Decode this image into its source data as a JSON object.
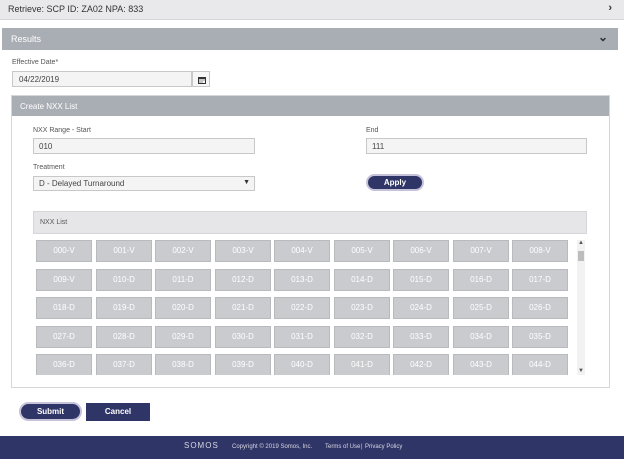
{
  "retrieve": {
    "title": "Retrieve: SCP ID: ZA02 NPA: 833",
    "chevron": "›"
  },
  "results": {
    "title": "Results",
    "chevron": "⌄"
  },
  "effective_date": {
    "label": "Effective Date*",
    "value": "04/22/2019",
    "icon": "calendar-icon"
  },
  "create": {
    "title": "Create NXX List",
    "range_start_label": "NXX Range - Start",
    "range_start_value": "010",
    "end_label": "End",
    "end_value": "111",
    "treatment_label": "Treatment",
    "treatment_value": "D - Delayed Turnaround",
    "apply_label": "Apply"
  },
  "nxx_list": {
    "label": "NXX List",
    "items": [
      "000-V",
      "001-V",
      "002-V",
      "003-V",
      "004-V",
      "005-V",
      "006-V",
      "007-V",
      "008-V",
      "009-V",
      "010-D",
      "011-D",
      "012-D",
      "013-D",
      "014-D",
      "015-D",
      "016-D",
      "017-D",
      "018-D",
      "019-D",
      "020-D",
      "021-D",
      "022-D",
      "023-D",
      "024-D",
      "025-D",
      "026-D",
      "027-D",
      "028-D",
      "029-D",
      "030-D",
      "031-D",
      "032-D",
      "033-D",
      "034-D",
      "035-D",
      "036-D",
      "037-D",
      "038-D",
      "039-D",
      "040-D",
      "041-D",
      "042-D",
      "043-D",
      "044-D"
    ]
  },
  "actions": {
    "submit": "Submit",
    "cancel": "Cancel"
  },
  "footer": {
    "logo": "SOMOS",
    "copyright": "Copyright © 2019 Somos, Inc.",
    "terms": "Terms of Use",
    "separator": "|",
    "privacy": "Privacy Policy"
  },
  "colors": {
    "navy": "#2f3566",
    "panel_header": "#a9adb4",
    "cell": "#c9cbcf"
  }
}
